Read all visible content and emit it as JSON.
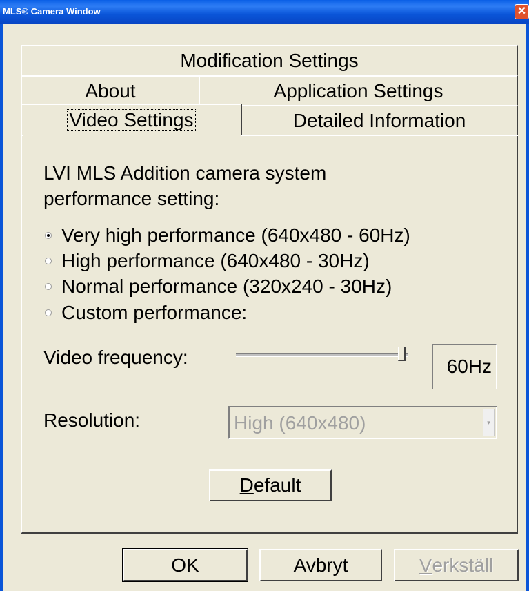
{
  "window": {
    "title": "MLS® Camera Window",
    "close_glyph": "✕"
  },
  "tabs": {
    "row1": [
      {
        "label": "Modification Settings"
      }
    ],
    "row2": [
      {
        "label": "About"
      },
      {
        "label": "Application Settings"
      }
    ],
    "row3": [
      {
        "label": "Video Settings",
        "active": true
      },
      {
        "label": "Detailed Information"
      }
    ]
  },
  "panel": {
    "heading_line1": "LVI MLS Addition camera system",
    "heading_line2": "performance setting:",
    "options": [
      {
        "label": "Very high performance (640x480 - 60Hz)",
        "checked": true
      },
      {
        "label": "High performance (640x480 - 30Hz)",
        "checked": false
      },
      {
        "label": "Normal performance (320x240 - 30Hz)",
        "checked": false
      },
      {
        "label": "Custom performance:",
        "checked": false
      }
    ],
    "video_frequency": {
      "label": "Video frequency:",
      "value": "60Hz",
      "slider_fraction": 1.0
    },
    "resolution": {
      "label": "Resolution:",
      "selected": "High (640x480)",
      "disabled": true
    },
    "default_button": {
      "accel": "D",
      "rest": "efault"
    }
  },
  "footer": {
    "ok_label": "OK",
    "cancel_label": "Avbryt",
    "apply_accel": "V",
    "apply_rest": "erkställ"
  }
}
